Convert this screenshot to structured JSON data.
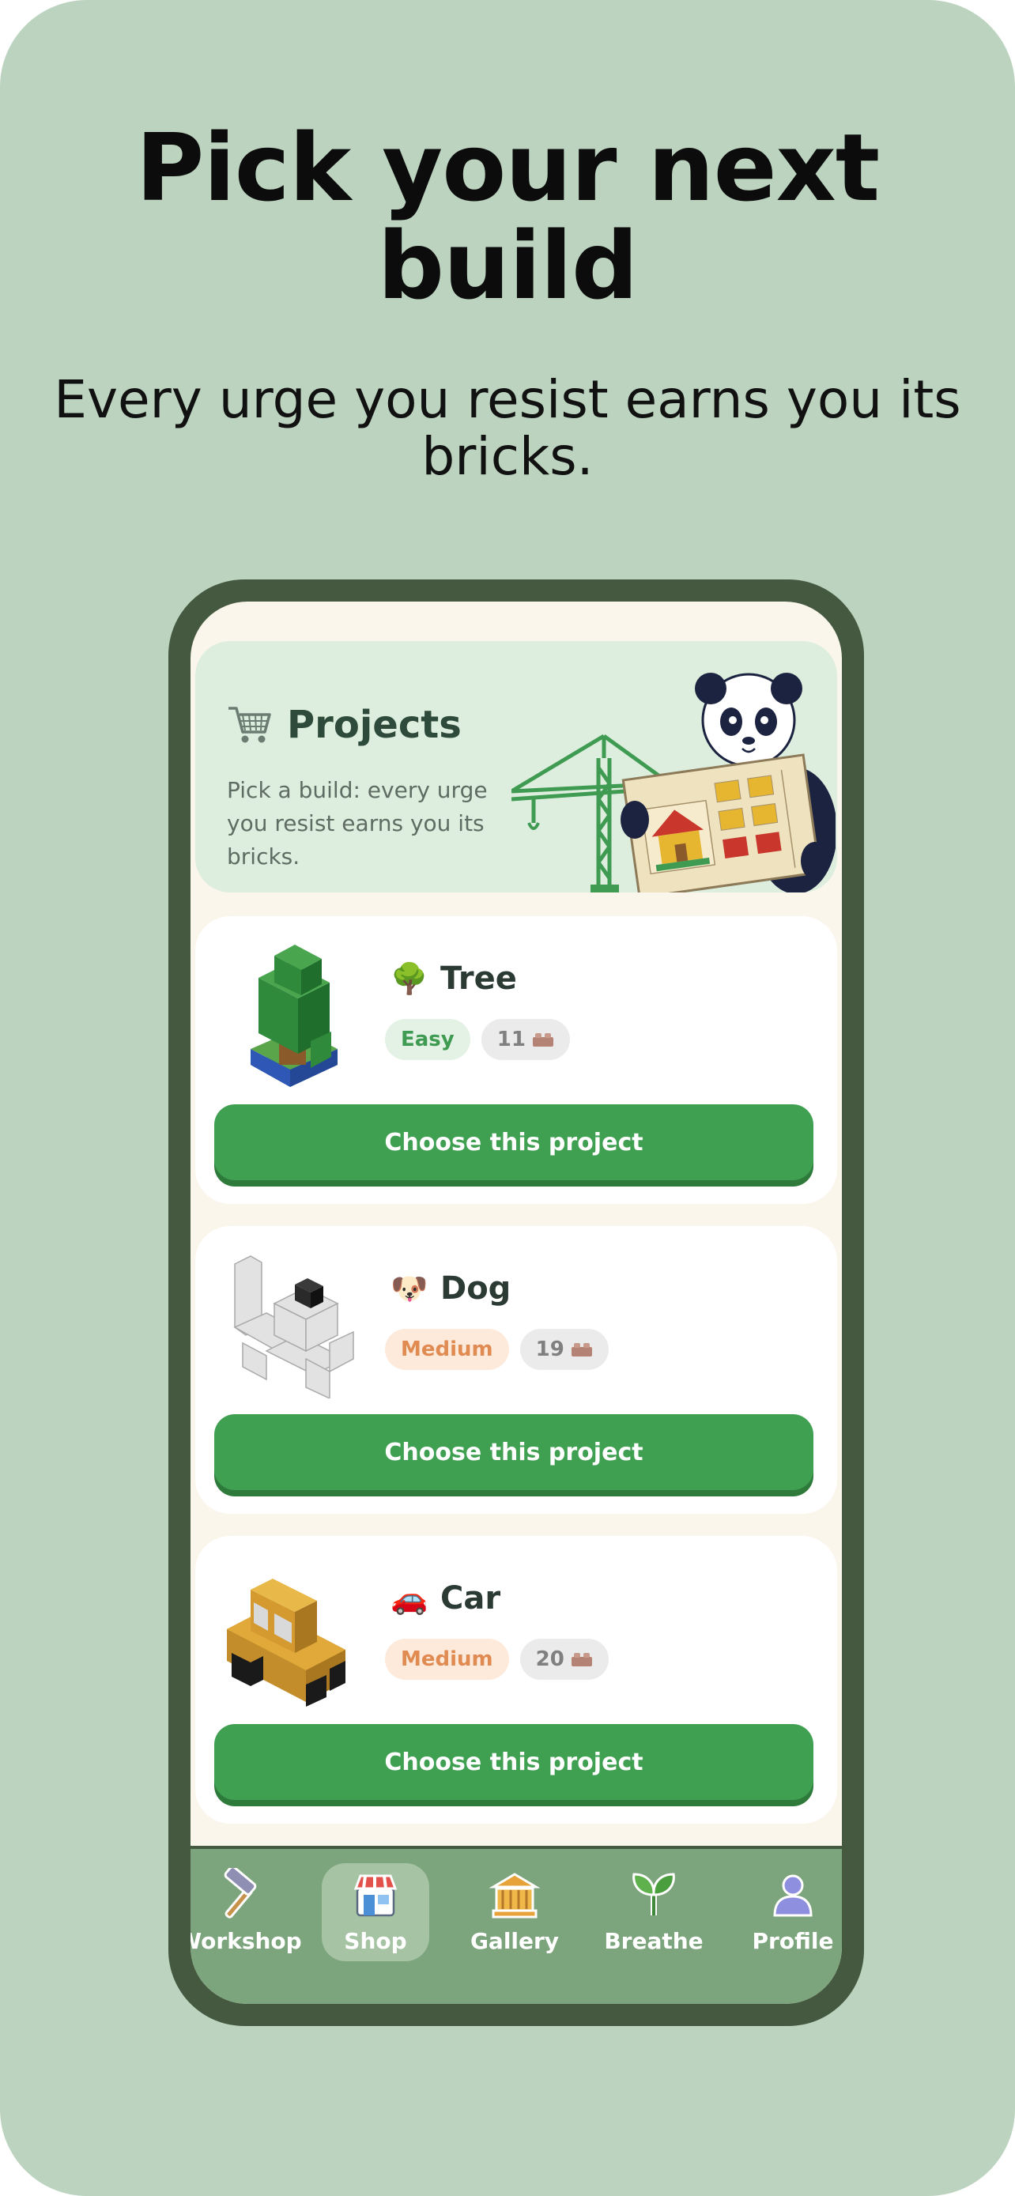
{
  "headline": "Pick your next build",
  "subheadline": "Every urge you resist earns you its bricks.",
  "app": {
    "header": {
      "icon": "shopping-cart-icon",
      "title": "Projects",
      "subtitle": "Pick a build: every urge you resist earns you its bricks."
    },
    "projects": [
      {
        "emoji": "🌳",
        "name": "Tree",
        "difficulty": "Easy",
        "bricks": "11",
        "button_label": "Choose this project"
      },
      {
        "emoji": "🐶",
        "name": "Dog",
        "difficulty": "Medium",
        "bricks": "19",
        "button_label": "Choose this project"
      },
      {
        "emoji": "🚗",
        "name": "Car",
        "difficulty": "Medium",
        "bricks": "20",
        "button_label": "Choose this project"
      }
    ],
    "tabs": [
      {
        "label": "Workshop",
        "icon": "hammer-icon"
      },
      {
        "label": "Shop",
        "icon": "store-icon",
        "active": true
      },
      {
        "label": "Gallery",
        "icon": "museum-icon"
      },
      {
        "label": "Breathe",
        "icon": "leaf-icon"
      },
      {
        "label": "Profile",
        "icon": "person-icon"
      }
    ]
  },
  "colors": {
    "background": "#bcd4bf",
    "phone_frame": "#44593f",
    "primary_button": "#40a051",
    "tab_bar": "#7da57d",
    "easy_badge_text": "#3f9a52",
    "medium_badge_text": "#e08b52"
  }
}
